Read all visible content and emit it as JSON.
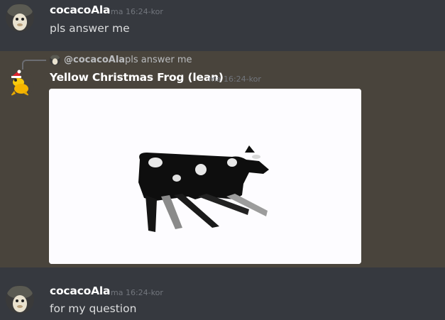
{
  "messages": [
    {
      "author": "cocacoAla",
      "timestamp": "ma 16:24-kor",
      "text": "pls answer me"
    },
    {
      "author": "Yellow Christmas Frog (lean)",
      "timestamp": "ma 16:24-kor",
      "reply": {
        "author": "@cocacoAla",
        "text": "pls answer me"
      },
      "attachment": {
        "icon": "dancing-cow-gif"
      }
    },
    {
      "author": "cocacoAla",
      "timestamp": "ma 16:24-kor",
      "text": "for my question"
    }
  ],
  "colors": {
    "background": "#36393f",
    "highlight_background": "#49443c",
    "username": "#ffffff",
    "timestamp": "#72767d",
    "message_text": "#dcddde"
  }
}
